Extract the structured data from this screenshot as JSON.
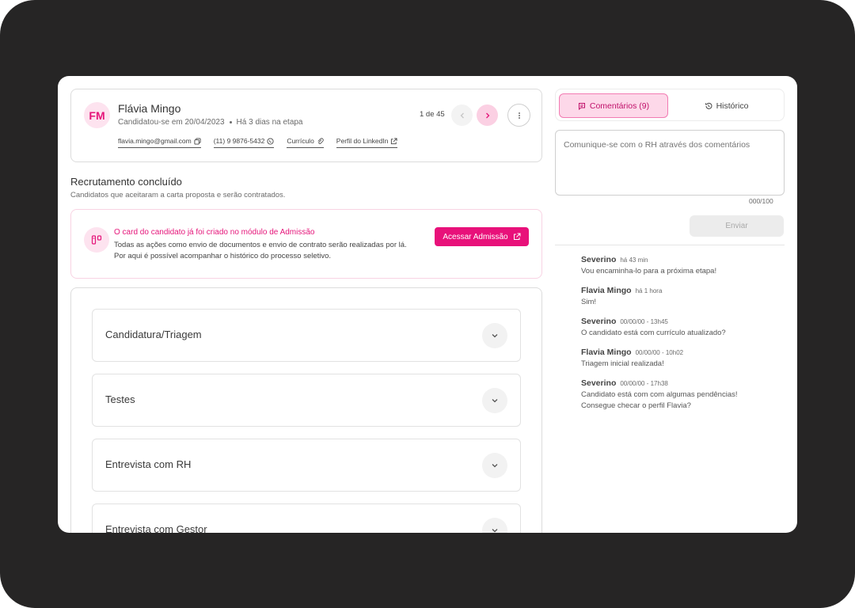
{
  "candidate": {
    "initials": "FM",
    "name": "Flávia Mingo",
    "applied": "Candidatou-se em 20/04/2023",
    "stage_time": "Há 3 dias na etapa",
    "links": {
      "email": "flavia.mingo@gmail.com",
      "phone": "(11) 9 9876-5432",
      "resume": "Currículo",
      "linkedin": "Perfil do LinkedIn"
    },
    "pager": "1 de 45"
  },
  "section": {
    "title": "Recrutamento concluído",
    "subtitle": "Candidatos que aceitaram a carta proposta e serão contratados."
  },
  "notice": {
    "title": "O card do candidato já foi criado no módulo de Admissão",
    "text": "Todas as ações como envio de documentos e envio de contrato serão realizadas por lá. Por aqui é possível acompanhar o histórico do processo seletivo.",
    "button_label": "Acessar Admissão"
  },
  "stages": [
    {
      "label": "Candidatura/Triagem"
    },
    {
      "label": "Testes"
    },
    {
      "label": "Entrevista com RH"
    },
    {
      "label": "Entrevista com Gestor"
    }
  ],
  "tabs": {
    "comments_label": "Comentários (9)",
    "history_label": "Histórico"
  },
  "comment_form": {
    "placeholder": "Comunique-se com o RH através dos comentários",
    "counter": "000/100",
    "send_label": "Enviar"
  },
  "comments": [
    {
      "author": "Severino",
      "time": "há 43 min",
      "text": "Vou encaminha-lo para a próxima etapa!"
    },
    {
      "author": "Flavia Mingo",
      "time": "há 1 hora",
      "text": "Sim!"
    },
    {
      "author": "Severino",
      "time": "00/00/00 - 13h45",
      "text": "O candidato está com currículo atualizado?"
    },
    {
      "author": "Flavia Mingo",
      "time": "00/00/00 - 10h02",
      "text": "Triagem inicial realizada!"
    },
    {
      "author": "Severino",
      "time": "00/00/00 - 17h38",
      "text": "Candidato está com com algumas pendências! Consegue checar o perfil Flavia?"
    }
  ],
  "colors": {
    "accent": "#e8117a",
    "accent_light": "#fde3ef",
    "frame": "#262525"
  }
}
